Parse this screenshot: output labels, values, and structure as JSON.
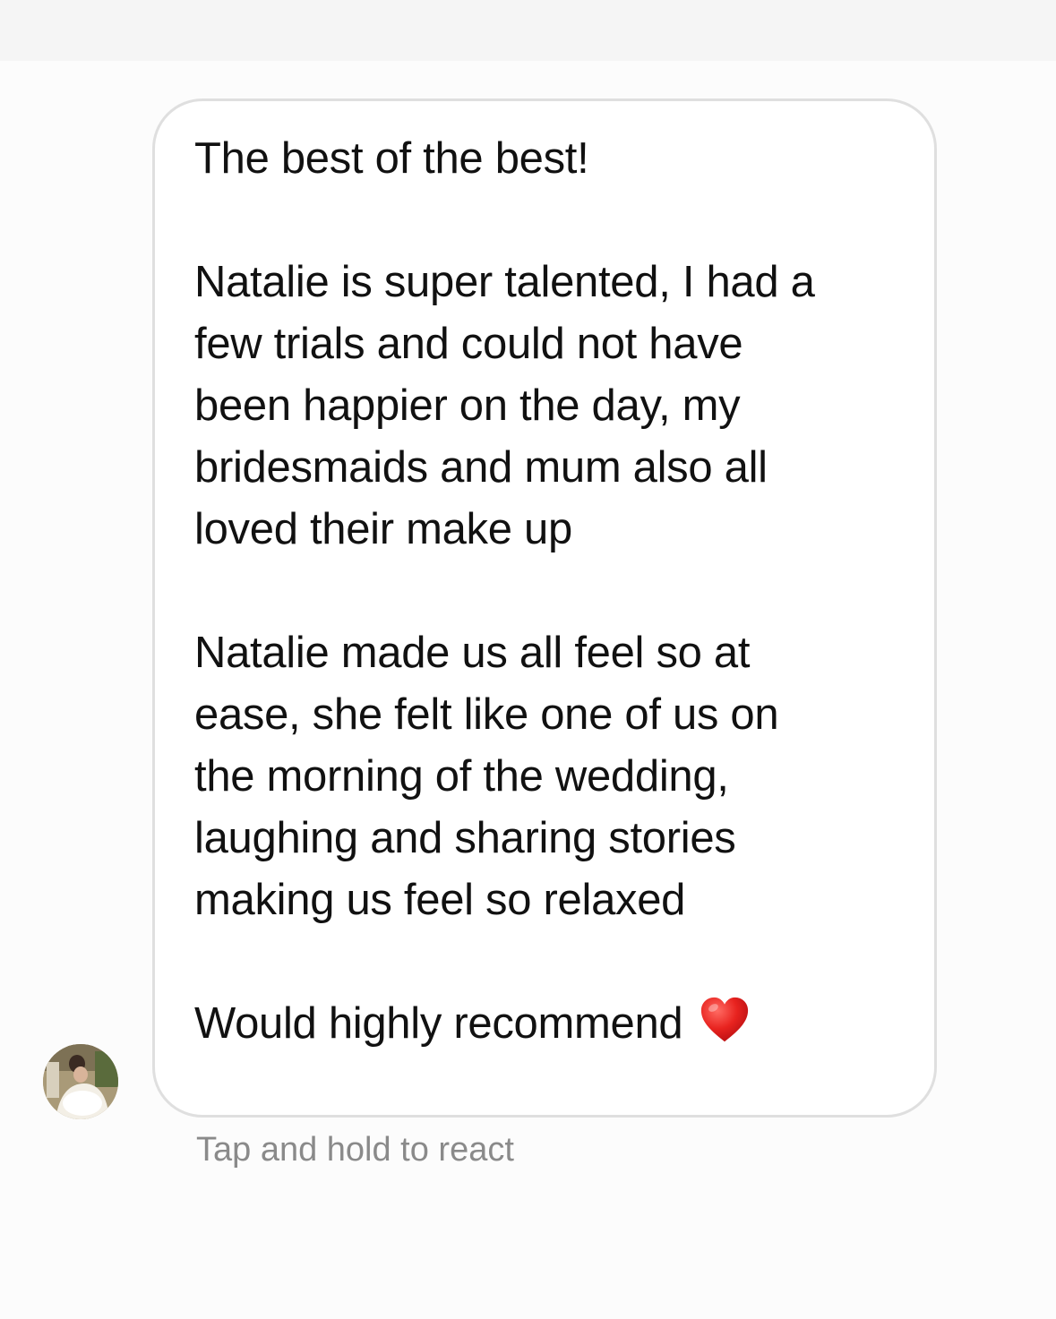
{
  "message": {
    "lines": [
      "The best of the best!",
      "",
      "Natalie is super talented, I had a",
      "few trials and could not have",
      "been happier on the day, my",
      "bridesmaids and mum also all",
      "loved their make up",
      "",
      "Natalie made us all feel so at",
      "ease, she felt like one of us on",
      "the morning of the wedding,",
      "laughing and sharing stories",
      "making us feel so relaxed",
      "",
      "Would highly recommend"
    ],
    "emoji": "heart-icon"
  },
  "reaction_hint": "Tap and hold to react",
  "sender": {
    "avatar": "avatar-photo"
  },
  "colors": {
    "background": "#fafafa",
    "bubble_border": "#dfdfdf",
    "text": "#111111",
    "hint_text": "#8a8a8a",
    "heart": "#e0201f"
  }
}
